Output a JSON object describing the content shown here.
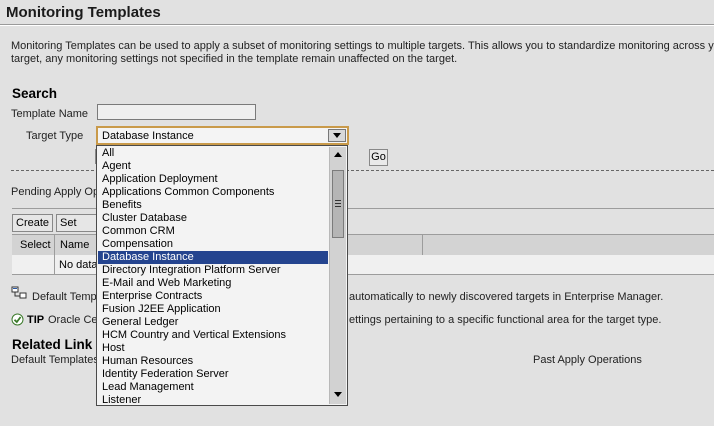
{
  "page": {
    "title": "Monitoring Templates",
    "description_line1": "Monitoring Templates can be used to apply a subset of monitoring settings to multiple targets. This allows you to standardize monitoring across your",
    "description_line2": "target, any monitoring settings not specified in the template remain unaffected on the target."
  },
  "search": {
    "heading": "Search",
    "template_name_label": "Template Name",
    "template_name_value": "",
    "target_type_label": "Target Type",
    "target_type_value": "Database Instance",
    "go_label": "Go"
  },
  "pending": {
    "label": "Pending Apply Op"
  },
  "toolbar": {
    "create_label": "Create",
    "set_default_label": "Set Defa"
  },
  "table": {
    "columns": [
      "Select",
      "Name"
    ],
    "empty_text": "No data"
  },
  "notes": {
    "default_templates_left": "Default Templ",
    "default_templates_right": "automatically to newly discovered targets in Enterprise Manager.",
    "tip_label": "TIP",
    "tip_left": "Oracle Cer",
    "tip_right": "ettings pertaining to a specific functional area for the target type."
  },
  "related": {
    "heading": "Related Link",
    "default_templates_link": "Default Templates",
    "past_apply_link": "Past Apply Operations"
  },
  "dropdown": {
    "options": [
      "All",
      "Agent",
      "Application Deployment",
      "Applications Common Components",
      "Benefits",
      "Cluster Database",
      "Common CRM",
      "Compensation",
      "Database Instance",
      "Directory Integration Platform Server",
      "E-Mail and Web Marketing",
      "Enterprise Contracts",
      "Fusion J2EE Application",
      "General Ledger",
      "HCM Country and Vertical Extensions",
      "Host",
      "Human Resources",
      "Identity Federation Server",
      "Lead Management",
      "Listener"
    ],
    "selected_index": 8
  },
  "colors": {
    "page_background": "#e1e1e1",
    "selection_highlight": "#24448f",
    "focus_border": "#c99a4a"
  }
}
